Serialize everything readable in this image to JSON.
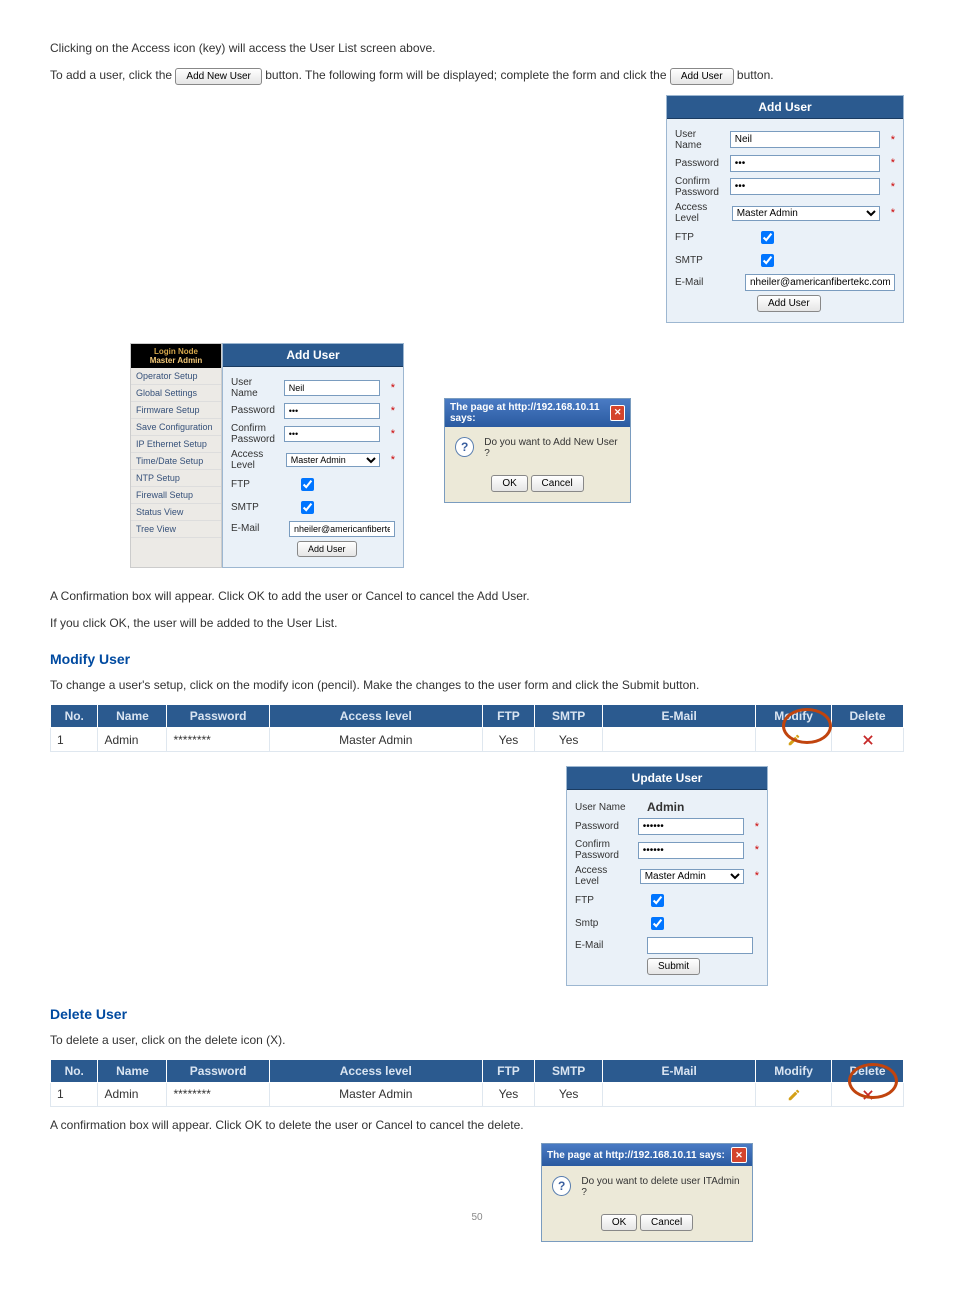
{
  "intro": {
    "p1": "Clicking on the Access icon (key) will access the User List screen above.",
    "p2_a": "To add a user, click the ",
    "p2_b": " button. The following form will be displayed; complete the form and click the ",
    "p2_c": " button.",
    "btn_add": "Add New User",
    "btn_adduser": "Add User"
  },
  "addUser": {
    "title": "Add User",
    "l_user": "User Name",
    "v_user": "Neil",
    "l_pass": "Password",
    "v_pass": "•••",
    "l_conf": "Confirm Password",
    "v_conf": "•••",
    "l_level": "Access Level",
    "v_level": "Master Admin",
    "l_ftp": "FTP",
    "v_ftp": true,
    "l_smtp": "SMTP",
    "v_smtp": true,
    "l_email": "E-Mail",
    "v_email": "nheiler@americanfibertekc.com",
    "btn": "Add User"
  },
  "sidebar": {
    "hd1": "Login Node",
    "hd2": "Master Admin",
    "items": [
      "Operator Setup",
      "Global Settings",
      "Firmware Setup",
      "Save Configuration",
      "IP Ethernet Setup",
      "Time/Date Setup",
      "NTP Setup",
      "Firewall Setup",
      "Status View",
      "Tree View"
    ]
  },
  "addUserSmall": {
    "title": "Add User",
    "l_user": "User Name",
    "v_user": "Neil",
    "l_pass": "Password",
    "v_pass": "•••",
    "l_conf": "Confirm Password",
    "v_conf": "•••",
    "l_level": "Access Level",
    "v_level": "Master Admin",
    "l_ftp": "FTP",
    "l_smtp": "SMTP",
    "l_email": "E-Mail",
    "v_email": "nheiler@americanfibertekc.com",
    "btn": "Add User"
  },
  "dlgAdd": {
    "title": "The page at http://192.168.10.11 says:",
    "msg": "Do you want to Add New User ?",
    "ok": "OK",
    "cancel": "Cancel"
  },
  "confirm_para": {
    "a": "A Confirmation box will appear. Click OK to add the user or Cancel to cancel the Add User.",
    "b": "If you click OK, the user will be added to the User List."
  },
  "modify": {
    "title": "Modify User",
    "p": "To change a user's setup, click on the modify icon (pencil). Make the changes to the user form and click the Submit button."
  },
  "ulist1": {
    "h": [
      "No.",
      "Name",
      "Password",
      "Access level",
      "FTP",
      "SMTP",
      "E-Mail",
      "Modify",
      "Delete"
    ],
    "r": [
      "1",
      "Admin",
      "********",
      "Master Admin",
      "Yes",
      "Yes",
      ""
    ]
  },
  "updateUser": {
    "title": "Update User",
    "l_user": "User Name",
    "v_user": "Admin",
    "l_pass": "Password",
    "v_pass": "••••••",
    "l_conf": "Confirm Password",
    "v_conf": "••••••",
    "l_level": "Access Level",
    "v_level": "Master Admin",
    "l_ftp": "FTP",
    "l_smtp": "Smtp",
    "l_email": "E-Mail",
    "v_email": "",
    "btn": "Submit"
  },
  "deleteSec": {
    "title": "Delete User",
    "p": "To delete a user, click on the delete icon (X)."
  },
  "ulist2": {
    "h": [
      "No.",
      "Name",
      "Password",
      "Access level",
      "FTP",
      "SMTP",
      "E-Mail",
      "Modify",
      "Delete"
    ],
    "r": [
      "1",
      "Admin",
      "********",
      "Master Admin",
      "Yes",
      "Yes",
      ""
    ]
  },
  "confirmDel": "A confirmation box will appear. Click OK to delete the user or Cancel to cancel the delete.",
  "dlgDel": {
    "title": "The page at http://192.168.10.11 says:",
    "msg": "Do you want to delete user ITAdmin ?",
    "ok": "OK",
    "cancel": "Cancel"
  },
  "pageno": "50"
}
